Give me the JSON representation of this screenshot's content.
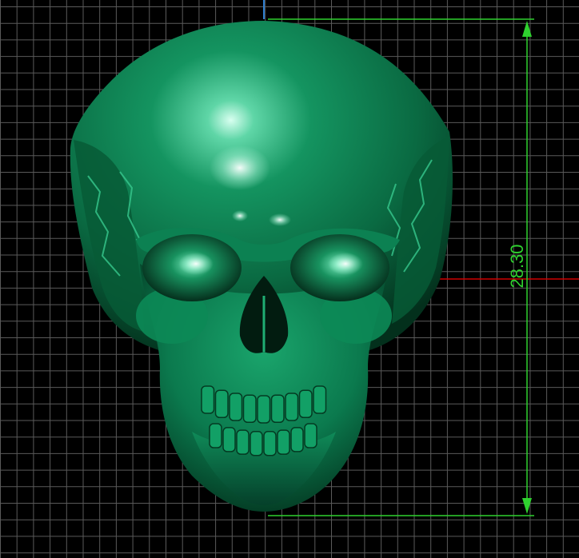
{
  "viewport": {
    "background_color": "#000000",
    "grid_color": "#5a5a5a",
    "model": {
      "name": "skull",
      "color": "#0b7a4e",
      "highlight": "#eafff6",
      "shadow": "#021c10"
    },
    "axes": {
      "x_axis_color": "#d00000",
      "y_axis_color": "#2f7fd0"
    },
    "dimension": {
      "value": "28.30",
      "color": "#2fd12f"
    }
  }
}
